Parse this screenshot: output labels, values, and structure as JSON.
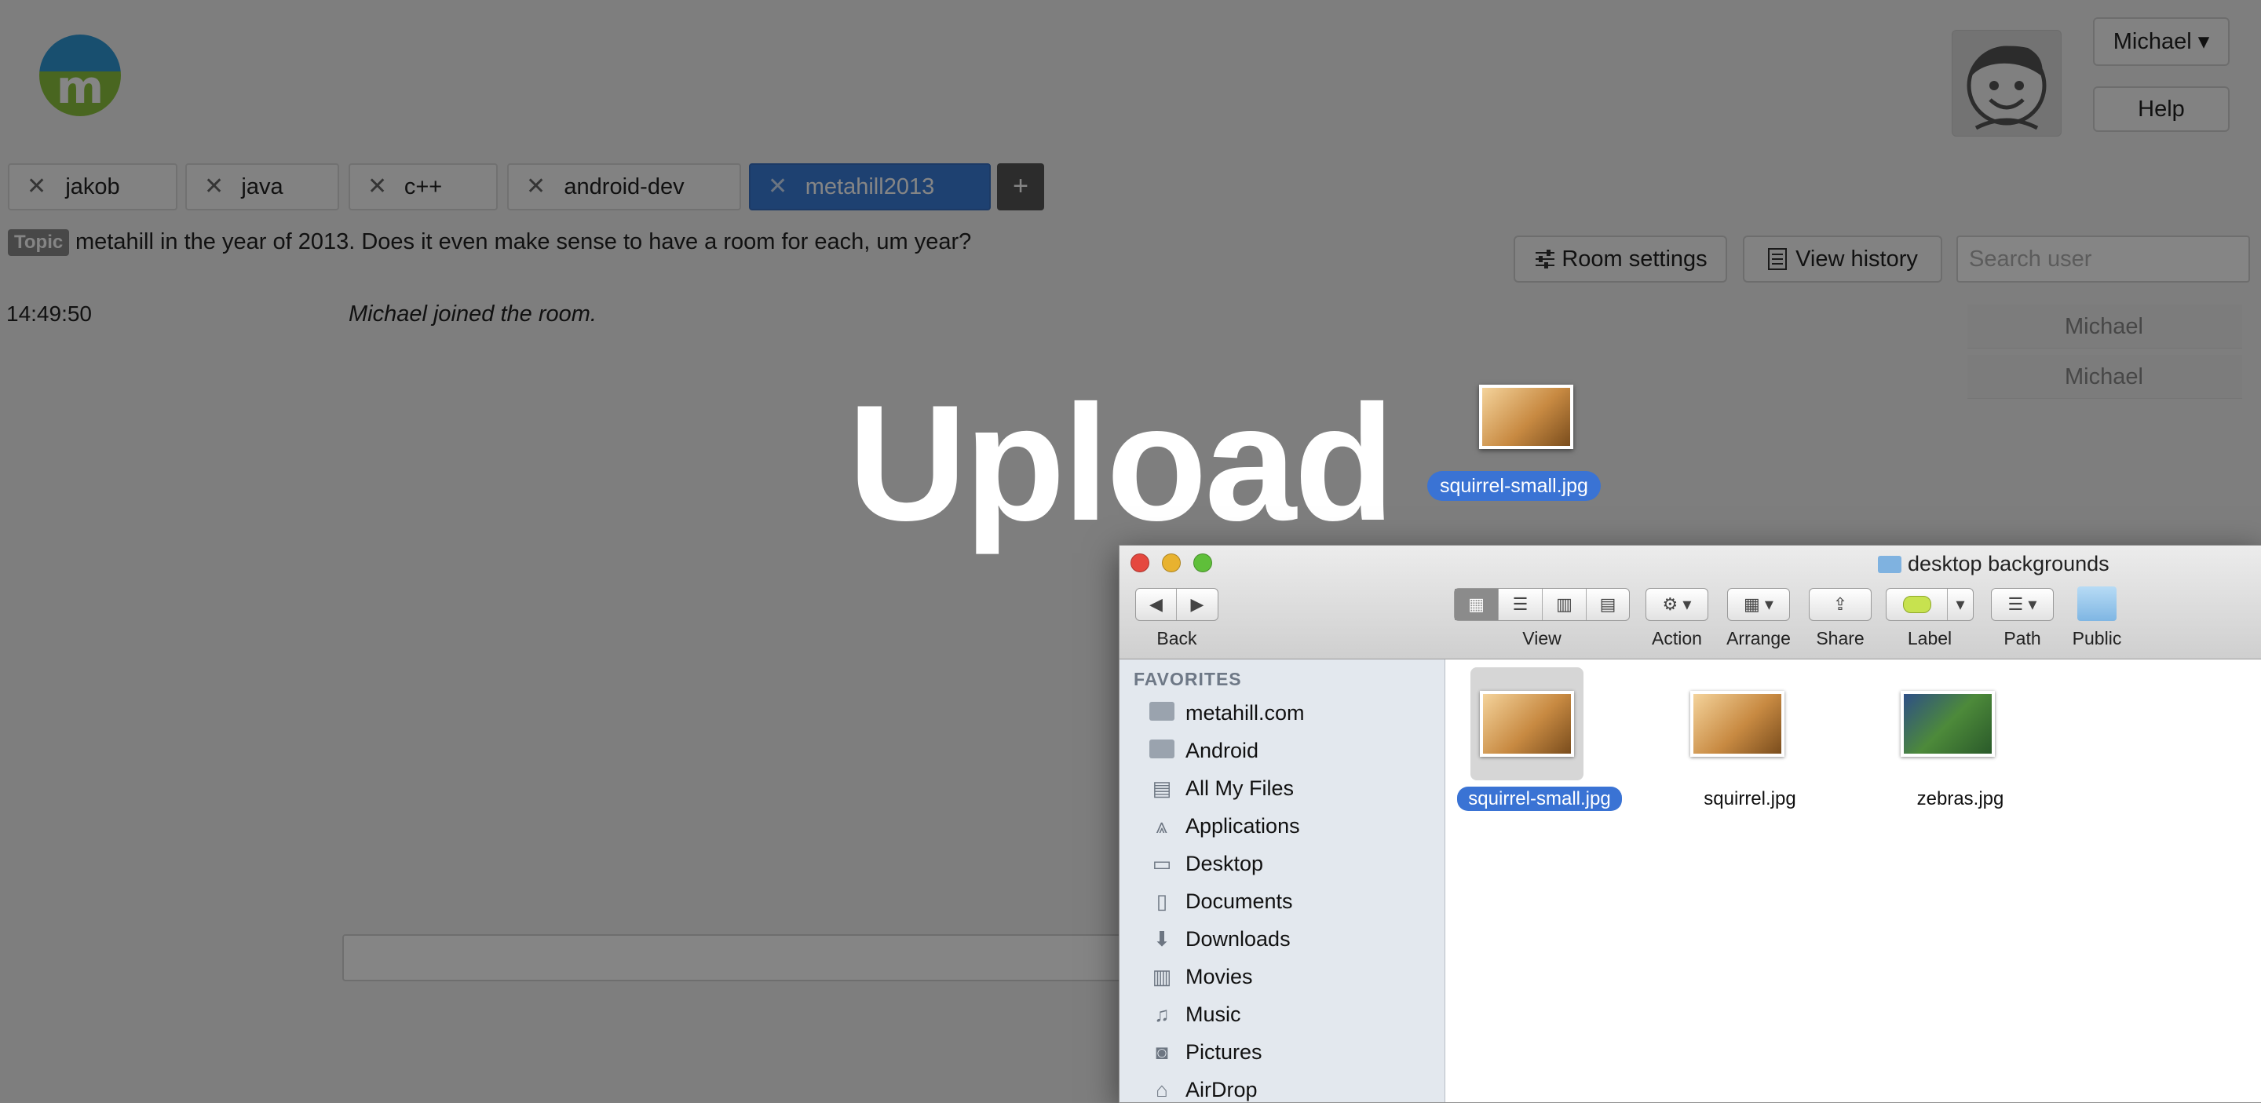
{
  "app": {
    "logo_letter": "m",
    "user_menu": "Michael ▾",
    "help": "Help",
    "tabs": [
      {
        "label": "jakob"
      },
      {
        "label": "java"
      },
      {
        "label": "c++"
      },
      {
        "label": "android-dev"
      },
      {
        "label": "metahill2013"
      }
    ],
    "tab_close": "✕",
    "tab_add": "+",
    "topic_badge": "Topic",
    "topic_text": "metahill in the year of 2013. Does it even make sense to have a room for each, um year?",
    "room_settings": "Room settings",
    "view_history": "View history",
    "search_placeholder": "Search user",
    "messages": [
      {
        "time": "14:49:50",
        "text": "Michael joined the room."
      }
    ],
    "users": [
      "Michael",
      "Michael"
    ]
  },
  "overlay": {
    "title": "Upload",
    "drag_file": "squirrel-small.jpg"
  },
  "finder": {
    "window_title": "desktop backgrounds",
    "toolbar": {
      "back": "Back",
      "view": "View",
      "action": "Action",
      "arrange": "Arrange",
      "share": "Share",
      "label": "Label",
      "path": "Path",
      "public": "Public"
    },
    "favorites_header": "FAVORITES",
    "favorites": [
      {
        "label": "metahill.com",
        "icon": "folder-icon"
      },
      {
        "label": "Android",
        "icon": "folder-icon"
      },
      {
        "label": "All My Files",
        "icon": "files-icon"
      },
      {
        "label": "Applications",
        "icon": "applications-icon"
      },
      {
        "label": "Desktop",
        "icon": "desktop-icon"
      },
      {
        "label": "Documents",
        "icon": "documents-icon"
      },
      {
        "label": "Downloads",
        "icon": "downloads-icon"
      },
      {
        "label": "Movies",
        "icon": "movies-icon"
      },
      {
        "label": "Music",
        "icon": "music-icon"
      },
      {
        "label": "Pictures",
        "icon": "pictures-icon"
      },
      {
        "label": "AirDrop",
        "icon": "airdrop-icon"
      }
    ],
    "files": [
      {
        "name": "squirrel-small.jpg",
        "selected": true
      },
      {
        "name": "squirrel.jpg",
        "selected": false
      },
      {
        "name": "zebras.jpg",
        "selected": false
      }
    ]
  },
  "colors": {
    "accent": "#3b7dd8",
    "selection": "#3a73d4",
    "sidebar": "#e3e8ee"
  }
}
